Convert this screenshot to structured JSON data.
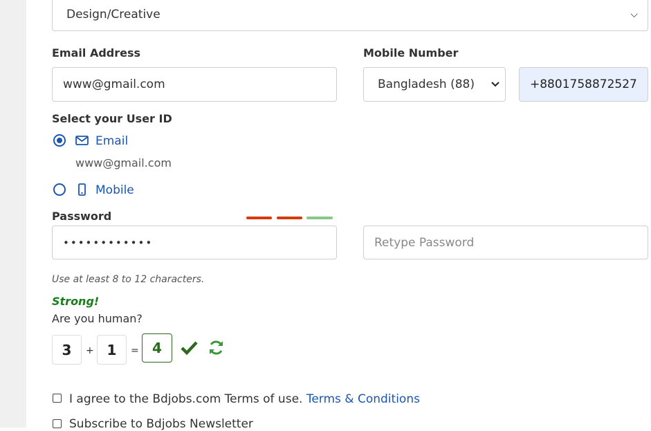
{
  "category": {
    "value": "Design/Creative"
  },
  "email": {
    "label": "Email Address",
    "value": "www@gmail.com"
  },
  "mobile": {
    "label": "Mobile Number",
    "country": "Bangladesh (88)",
    "number": "+8801758872527"
  },
  "user_id": {
    "label": "Select your User ID",
    "options": [
      {
        "label": "Email",
        "icon": "mail-icon",
        "selected": true,
        "detail": "www@gmail.com"
      },
      {
        "label": "Mobile",
        "icon": "phone-icon",
        "selected": false
      }
    ]
  },
  "password": {
    "label": "Password",
    "masked_value": "••••••••••••",
    "retype_placeholder": "Retype Password",
    "hint": "Use at least 8 to 12 characters.",
    "strength_text": "Strong!",
    "strength_colors": [
      "#d63a0a",
      "#d63a0a",
      "#86c987"
    ]
  },
  "captcha": {
    "question": "Are you human?",
    "a": "3",
    "op": "+",
    "b": "1",
    "eq": "=",
    "answer": "4"
  },
  "terms": {
    "text": "I agree to the Bdjobs.com Terms of use.",
    "link": "Terms & Conditions",
    "newsletter": "Subscribe to Bdjobs Newsletter"
  },
  "colors": {
    "accent": "#1a56b0",
    "success": "#1a7f1a",
    "phone_bg": "#e8f0fe"
  }
}
